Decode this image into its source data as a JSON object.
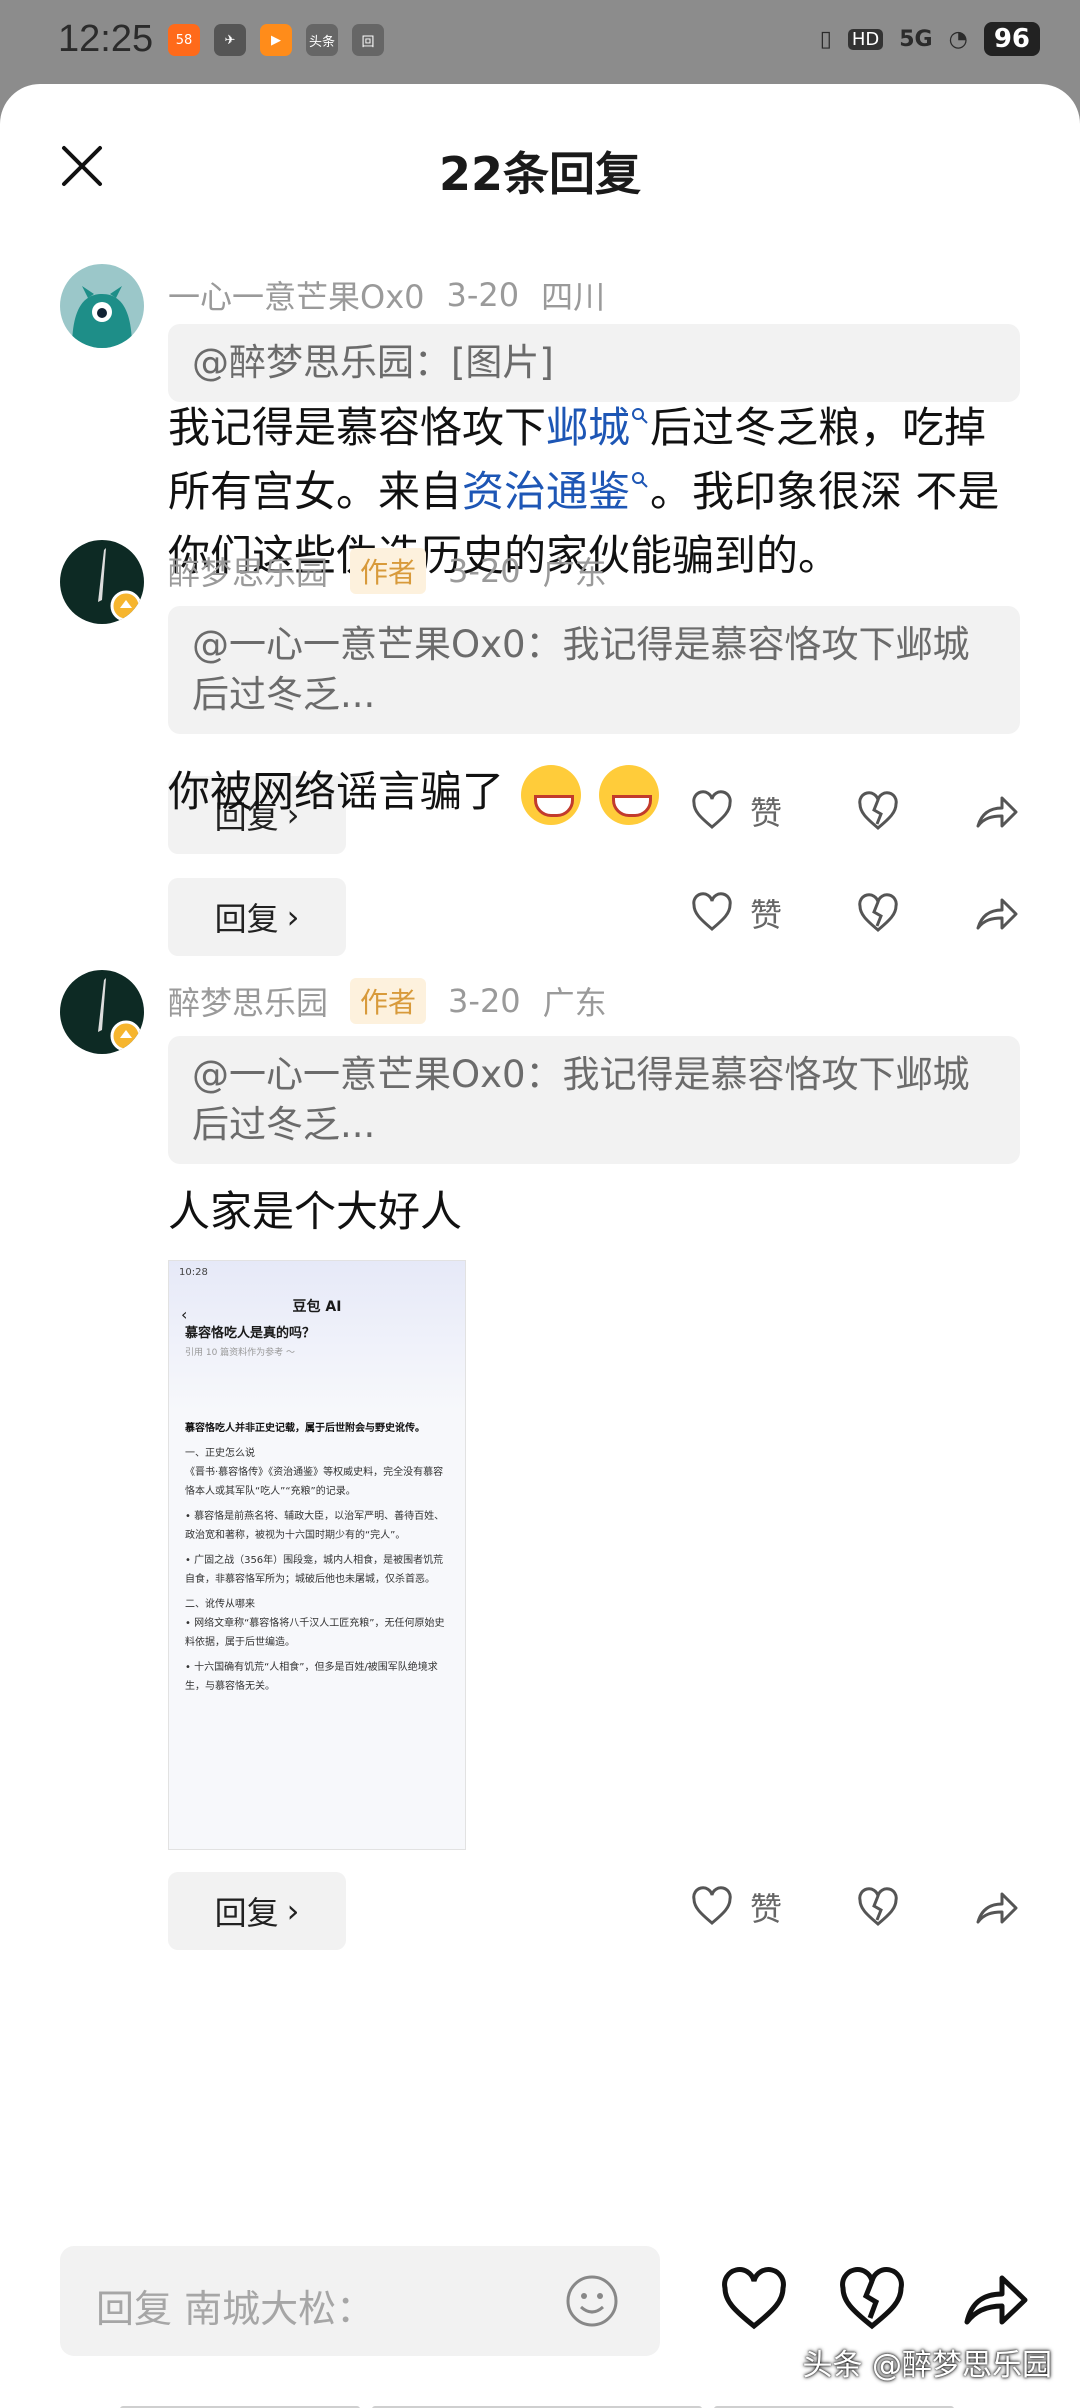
{
  "status": {
    "time": "12:25",
    "apps": [
      "app-orange",
      "app-rocket",
      "app-video",
      "头条",
      "app-square"
    ],
    "network": "5G",
    "hd": "HD",
    "battery": "96"
  },
  "sheet": {
    "title": "22条回复"
  },
  "comments": [
    {
      "user": "一心一意芒果Ox0",
      "date": "3-20",
      "location": "四川",
      "quote": "@醉梦思乐园：[图片]",
      "text_parts": [
        "我记得是慕容恪攻下",
        "邺城",
        "后过冬乏粮，吃掉所有宫女。来自",
        "资治通鉴",
        "。我印象很深 不是你们这些伪造历史的家伙能骗到的。"
      ],
      "reply_label": "回复",
      "like_label": "赞"
    },
    {
      "user": "醉梦思乐园",
      "tag": "作者",
      "date": "3-20",
      "location": "广东",
      "quote": "@一心一意芒果Ox0：我记得是慕容恪攻下邺城后过冬乏...",
      "text": "你被网络谣言骗了",
      "reply_label": "回复",
      "like_label": "赞"
    },
    {
      "user": "醉梦思乐园",
      "tag": "作者",
      "date": "3-20",
      "location": "广东",
      "quote": "@一心一意芒果Ox0：我记得是慕容恪攻下邺城后过冬乏...",
      "text": "人家是个大好人",
      "reply_label": "回复",
      "like_label": "赞",
      "image": {
        "status_time": "10:28",
        "title": "豆包 AI",
        "question": "慕容恪吃人是真的吗？",
        "ref": "引用 10 篇资料作为参考 ～",
        "lines": [
          "慕容恪吃人并非正史记载，属于后世附会与野史讹传。",
          "一、正史怎么说",
          "《晋书·慕容恪传》《资治通鉴》等权威史料，完全没有慕容恪本人或其军队“吃人”“充粮”的记录。",
          "• 慕容恪是前燕名将、辅政大臣，以治军严明、善待百姓、政治宽和著称，被视为十六国时期少有的“完人”。",
          "• 广固之战（356年）围段龛，城内人相食，是被围者饥荒自食，非慕容恪军所为；城破后他也未屠城，仅杀首恶。",
          "二、讹传从哪来",
          "• 网络文章称“慕容恪将八千汉人工匠充粮”，无任何原始史料依据，属于后世编造。",
          "• 十六国确有饥荒“人相食”，但多是百姓/被围军队绝境求生，与慕容恪无关。"
        ]
      }
    }
  ],
  "bottom": {
    "input_placeholder": "回复 南城大松：",
    "watermark": "头条 @醉梦思乐园"
  }
}
